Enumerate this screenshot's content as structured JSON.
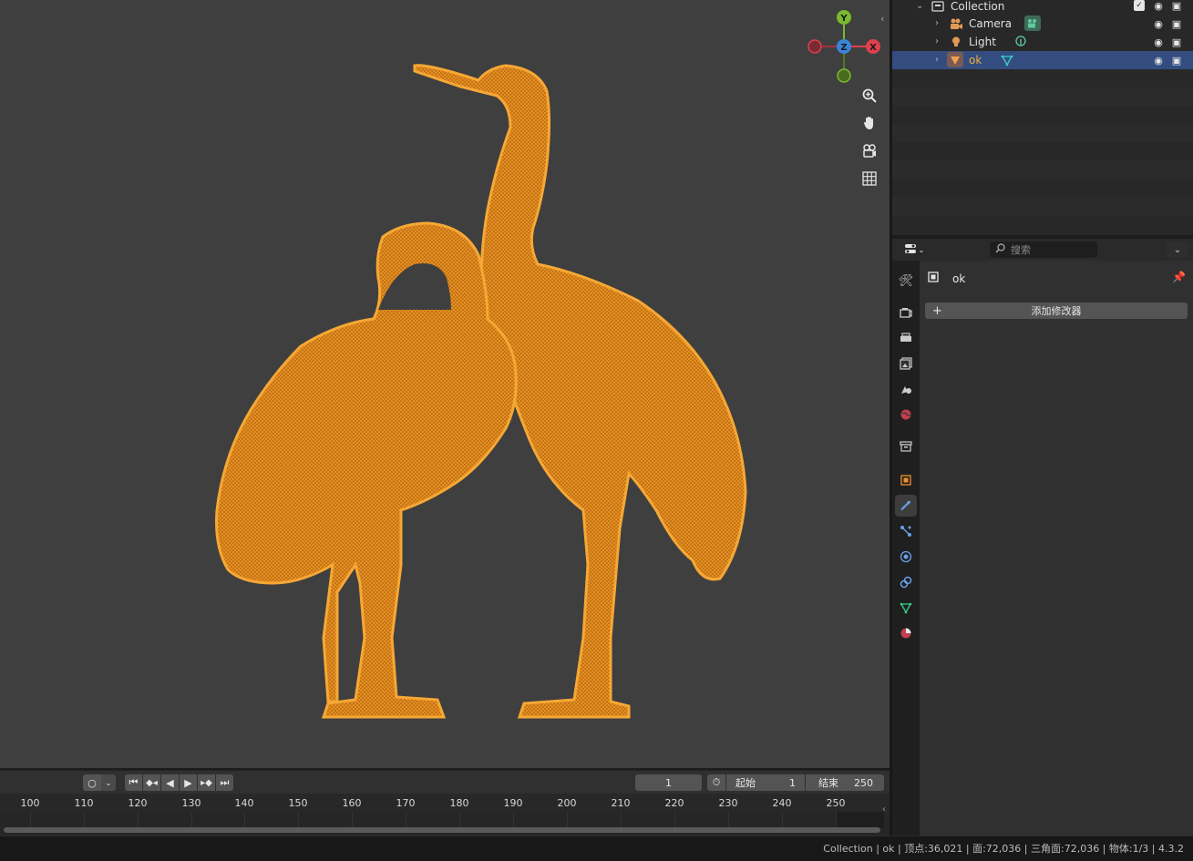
{
  "viewport": {
    "gizmo": {
      "x_label": "X",
      "y_label": "Y",
      "z_label": "Z",
      "x_color": "#e0404c",
      "y_color": "#7ab830",
      "z_color": "#3a84d8"
    },
    "nav_buttons": [
      "zoom-icon",
      "hand-pan-icon",
      "camera-view-icon",
      "grid-ortho-icon"
    ],
    "mesh_color": "#f0a030"
  },
  "timeline": {
    "playback_mode": "○",
    "current_frame": "1",
    "start_label": "起始",
    "start_value": "1",
    "end_label": "结束",
    "end_value": "250",
    "ticks": [
      "100",
      "110",
      "120",
      "130",
      "140",
      "150",
      "160",
      "170",
      "180",
      "190",
      "200",
      "210",
      "220",
      "230",
      "240",
      "250"
    ]
  },
  "outliner": {
    "collection": "Collection",
    "items": [
      {
        "label": "Camera",
        "icon": "camera-icon",
        "data_icon": "camera-data-icon"
      },
      {
        "label": "Light",
        "icon": "light-icon",
        "data_icon": "light-data-icon"
      },
      {
        "label": "ok",
        "icon": "mesh-object-icon",
        "data_icon": "mesh-data-icon",
        "selected": true
      }
    ]
  },
  "properties": {
    "search_placeholder": "搜索",
    "object_name": "ok",
    "add_modifier": "添加修改器",
    "tabs": [
      "tool-icon",
      "render-icon",
      "output-icon",
      "view-layer-icon",
      "scene-icon",
      "world-icon",
      "collection-icon",
      "object-icon",
      "modifier-icon",
      "particles-icon",
      "physics-icon",
      "constraints-icon",
      "data-icon",
      "material-icon"
    ],
    "active_tab": "modifier-icon"
  },
  "statusbar": {
    "text": "Collection | ok | 顶点:36,021 | 面:72,036 | 三角面:72,036 | 物体:1/3 | 4.3.2"
  }
}
